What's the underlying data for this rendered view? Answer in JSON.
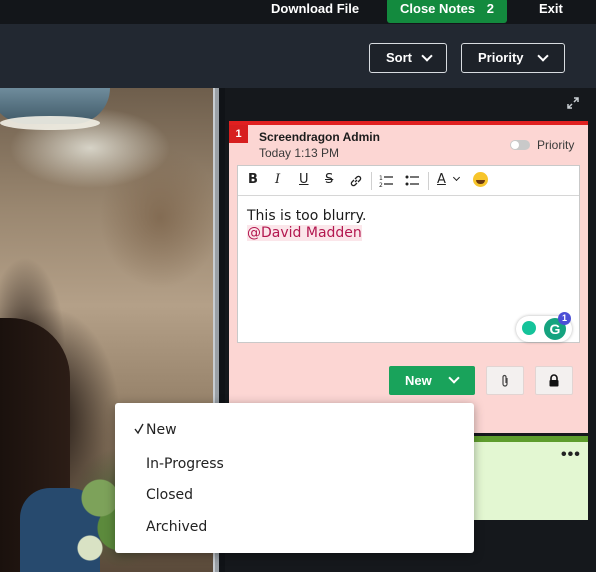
{
  "topbar": {
    "download_label": "Download File",
    "close_notes_label": "Close Notes",
    "close_notes_count": "2",
    "exit_label": "Exit"
  },
  "toolbar": {
    "sort_label": "Sort",
    "priority_label": "Priority"
  },
  "note": {
    "number": "1",
    "author": "Screendragon Admin",
    "time": "Today 1:13 PM",
    "priority_toggle_label": "Priority",
    "priority_on": false,
    "body_text": "This is too blurry.",
    "mention": "@David Madden",
    "status_label": "New",
    "grammarly_count": "1",
    "color": "#fcd6d3",
    "accent": "#e02020"
  },
  "editor_tools": [
    "bold-icon",
    "italic-icon",
    "underline-icon",
    "strikethrough-icon",
    "link-icon",
    "numbered-list-icon",
    "bulleted-list-icon",
    "text-color-icon",
    "emoji-icon"
  ],
  "note2": {
    "color": "#e3f7d2",
    "accent": "#5e9d2d"
  },
  "status_menu": {
    "items": [
      {
        "label": "New",
        "selected": true
      },
      {
        "label": "In-Progress",
        "selected": false
      },
      {
        "label": "Closed",
        "selected": false
      },
      {
        "label": "Archived",
        "selected": false
      }
    ]
  },
  "colors": {
    "green": "#19a35b",
    "close_notes_green": "#138a3e",
    "mention": "#b3174f"
  }
}
